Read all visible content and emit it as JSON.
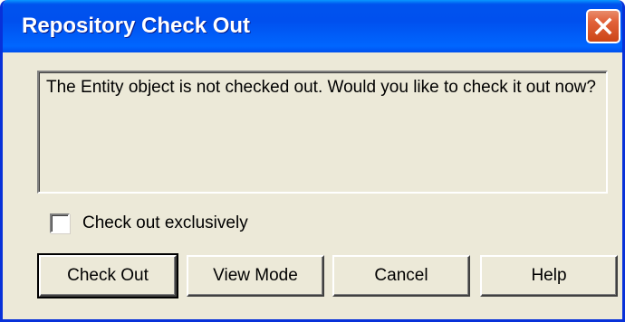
{
  "window": {
    "title": "Repository Check Out"
  },
  "message": "The Entity object is not checked out.  Would you like to check it out now?",
  "checkbox": {
    "label": "Check out exclusively",
    "checked": false
  },
  "buttons": {
    "check_out": "Check Out",
    "view_mode": "View Mode",
    "cancel": "Cancel",
    "help": "Help"
  },
  "icons": {
    "close": "close-icon"
  },
  "colors": {
    "titlebar": "#0053ee",
    "dialog_bg": "#ece9d8",
    "close_button": "#e2623a"
  }
}
